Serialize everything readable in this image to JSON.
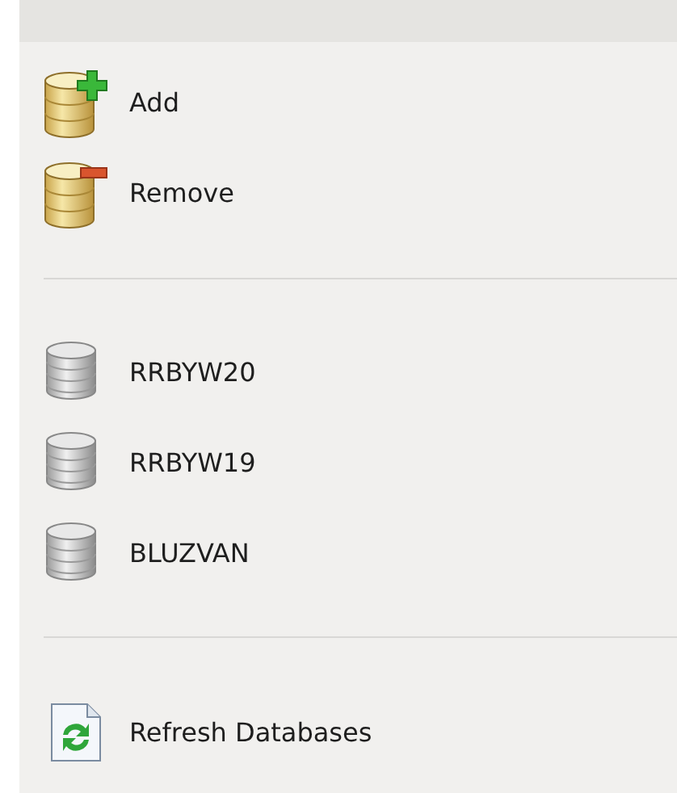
{
  "groups": [
    {
      "items": [
        {
          "kind": "add",
          "label": "Add"
        },
        {
          "kind": "remove",
          "label": "Remove"
        }
      ]
    },
    {
      "items": [
        {
          "kind": "database",
          "label": "RRBYW20"
        },
        {
          "kind": "database",
          "label": "RRBYW19"
        },
        {
          "kind": "database",
          "label": "BLUZVAN"
        }
      ]
    },
    {
      "items": [
        {
          "kind": "refresh",
          "label": "Refresh Databases"
        }
      ]
    }
  ]
}
